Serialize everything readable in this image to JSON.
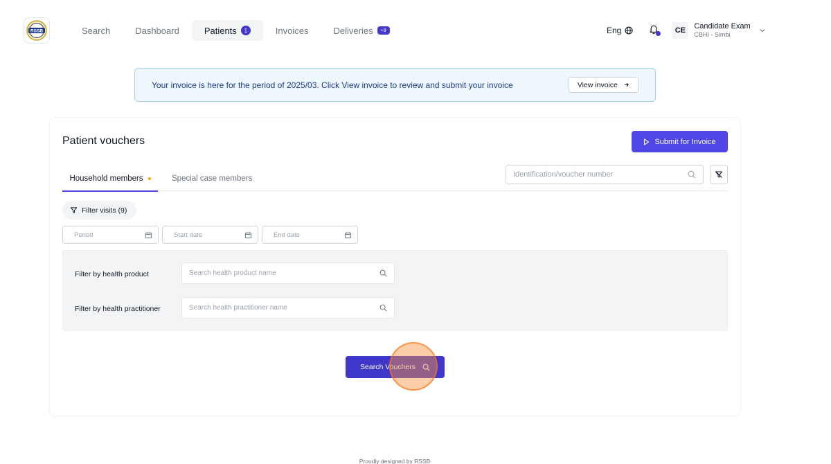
{
  "brand": {
    "logo_text": "RSSB"
  },
  "nav": {
    "items": [
      {
        "label": "Search"
      },
      {
        "label": "Dashboard"
      },
      {
        "label": "Patients",
        "badge": "1"
      },
      {
        "label": "Invoices"
      },
      {
        "label": "Deliveries",
        "badge": "+9"
      }
    ],
    "active": "Patients"
  },
  "header_right": {
    "language": "Eng",
    "user_initials": "CE",
    "user_name": "Candidate Exam",
    "user_org": "CBHI - Simbi"
  },
  "banner": {
    "text": "Your invoice is here for the period of 2025/03. Click View invoice to review and submit your invoice",
    "button_label": "View invoice"
  },
  "card": {
    "title": "Patient vouchers",
    "submit_label": "Submit for Invoice",
    "tabs": [
      {
        "label": "Household members",
        "active": true
      },
      {
        "label": "Special case members",
        "active": false
      }
    ],
    "id_search_placeholder": "Identification/voucher number",
    "filter_visits_label": "Filter visits (9)",
    "date_fields": {
      "period_placeholder": "Period",
      "start_placeholder": "Start date",
      "end_placeholder": "End date"
    },
    "filters": {
      "product_label": "Filter by health product",
      "product_placeholder": "Search health product name",
      "practitioner_label": "Filter by health practitioner",
      "practitioner_placeholder": "Search health practitioner name"
    },
    "search_button_label": "Search Vouchers"
  },
  "footer": {
    "text": "Proudly designed by RSSB"
  },
  "colors": {
    "primary": "#4f46e5",
    "primary_dark": "#3f37c9",
    "banner_bg": "#eef7fc",
    "banner_border": "#a5d0e8",
    "tab_dot": "#f59e0b"
  }
}
